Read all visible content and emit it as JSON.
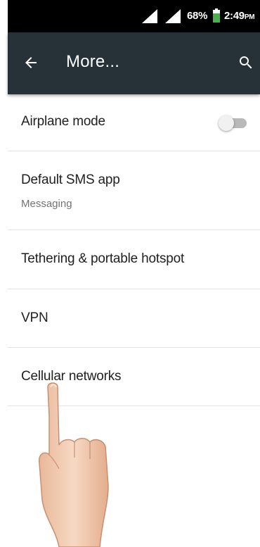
{
  "status_bar": {
    "battery_percent": "68%",
    "time": "2:49",
    "time_suffix": "PM",
    "battery_color": "#4caf50"
  },
  "app_bar": {
    "title": "More...",
    "background": "#263238",
    "back_icon": "arrow-left-icon",
    "search_icon": "search-icon"
  },
  "settings": {
    "airplane_mode": {
      "label": "Airplane mode",
      "enabled": false
    },
    "default_sms": {
      "label": "Default SMS app",
      "value": "Messaging"
    },
    "tethering": {
      "label": "Tethering & portable hotspot"
    },
    "vpn": {
      "label": "VPN"
    },
    "cellular": {
      "label": "Cellular networks"
    }
  }
}
